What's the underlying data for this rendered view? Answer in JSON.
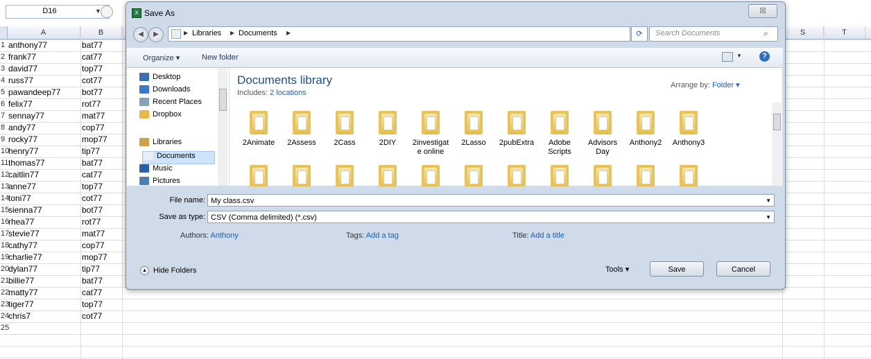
{
  "sheet": {
    "namebox": "D16",
    "columns": [
      "A",
      "B",
      "S",
      "T"
    ],
    "rows": [
      {
        "n": "1",
        "a": "anthony77",
        "b": "bat77"
      },
      {
        "n": "2",
        "a": "frank77",
        "b": "cat77"
      },
      {
        "n": "3",
        "a": "david77",
        "b": "top77"
      },
      {
        "n": "4",
        "a": "russ77",
        "b": "cot77"
      },
      {
        "n": "5",
        "a": "pawandeep77",
        "b": "bot77"
      },
      {
        "n": "6",
        "a": "felix77",
        "b": "rot77"
      },
      {
        "n": "7",
        "a": "sennay77",
        "b": "mat77"
      },
      {
        "n": "8",
        "a": "andy77",
        "b": "cop77"
      },
      {
        "n": "9",
        "a": "rocky77",
        "b": "mop77"
      },
      {
        "n": "10",
        "a": "henry77",
        "b": "tip77"
      },
      {
        "n": "11",
        "a": "thomas77",
        "b": "bat77"
      },
      {
        "n": "12",
        "a": "caitlin77",
        "b": "cat77"
      },
      {
        "n": "13",
        "a": "anne77",
        "b": "top77"
      },
      {
        "n": "14",
        "a": "toni77",
        "b": "cot77"
      },
      {
        "n": "15",
        "a": "sienna77",
        "b": "bot77"
      },
      {
        "n": "16",
        "a": "rhea77",
        "b": "rot77"
      },
      {
        "n": "17",
        "a": "stevie77",
        "b": "mat77"
      },
      {
        "n": "18",
        "a": "cathy77",
        "b": "cop77"
      },
      {
        "n": "19",
        "a": "charlie77",
        "b": "mop77"
      },
      {
        "n": "20",
        "a": "dylan77",
        "b": "tip77"
      },
      {
        "n": "21",
        "a": "billie77",
        "b": "bat77"
      },
      {
        "n": "22",
        "a": "matty77",
        "b": "cat77"
      },
      {
        "n": "23",
        "a": "tiger77",
        "b": "top77"
      },
      {
        "n": "24",
        "a": "chris7",
        "b": "cot77"
      },
      {
        "n": "25",
        "a": "",
        "b": ""
      }
    ]
  },
  "dialog": {
    "title": "Save As",
    "close": "☒",
    "breadcrumb": [
      "Libraries",
      "Documents"
    ],
    "search_placeholder": "Search Documents",
    "toolbar": {
      "organize": "Organize ▾",
      "new_folder": "New folder"
    },
    "nav": {
      "items": [
        {
          "label": "Desktop",
          "icon": "desktop-icon",
          "color": "#3b6fb5"
        },
        {
          "label": "Downloads",
          "icon": "downloads-icon",
          "color": "#3a78c9"
        },
        {
          "label": "Recent Places",
          "icon": "recent-places-icon",
          "color": "#8aa0b8"
        },
        {
          "label": "Dropbox",
          "icon": "dropbox-icon",
          "color": "#e6b94b"
        },
        {
          "label": "Libraries",
          "icon": "libraries-icon",
          "color": "#c9a24a"
        },
        {
          "label": "Documents",
          "icon": "documents-icon",
          "color": "#e9eef5"
        },
        {
          "label": "Music",
          "icon": "music-icon",
          "color": "#2b5fa8"
        },
        {
          "label": "Pictures",
          "icon": "pictures-icon",
          "color": "#4e7db3"
        }
      ]
    },
    "library": {
      "title": "Documents library",
      "includes_label": "Includes:",
      "includes_link": "2 locations",
      "arrange_label": "Arrange by:",
      "arrange_value": "Folder ▾"
    },
    "folders": [
      "2Animate",
      "2Assess",
      "2Cass",
      "2DIY",
      "2investigat e online",
      "2Lasso",
      "2pubExtra",
      "Adobe Scripts",
      "Advisors Day",
      "Anthony2",
      "Anthony3"
    ],
    "file_name_label": "File name:",
    "file_name": "My class.csv",
    "save_type_label": "Save as type:",
    "save_type": "CSV (Comma delimited) (*.csv)",
    "authors_label": "Authors:",
    "authors": "Anthony",
    "tags_label": "Tags:",
    "tags": "Add a tag",
    "title_label": "Title:",
    "title_value": "Add a title",
    "hide_folders": "Hide Folders",
    "tools": "Tools ▾",
    "save": "Save",
    "cancel": "Cancel"
  }
}
